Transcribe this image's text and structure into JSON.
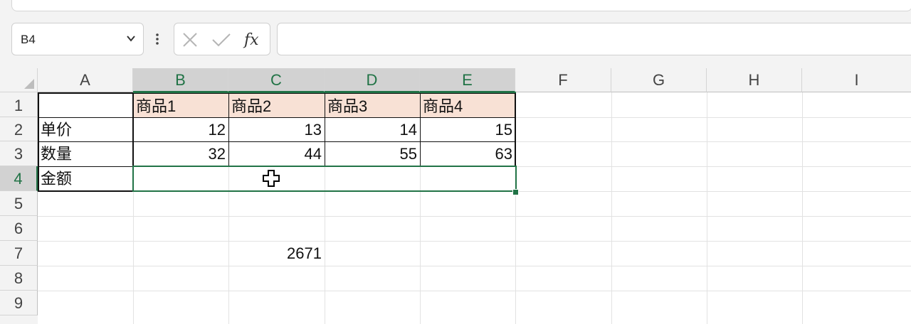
{
  "formula_bar": {
    "name_box": "B4",
    "cancel_icon": "cancel-icon",
    "enter_icon": "check-icon",
    "fx_icon": "fx-icon",
    "formula": ""
  },
  "columns": [
    "A",
    "B",
    "C",
    "D",
    "E",
    "F",
    "G",
    "H",
    "I"
  ],
  "rows": [
    "1",
    "2",
    "3",
    "4",
    "5",
    "6",
    "7",
    "8",
    "9"
  ],
  "selected_cell": "B4",
  "selection_range": "B4:E4",
  "cells": {
    "B1": "商品1",
    "C1": "商品2",
    "D1": "商品3",
    "E1": "商品4",
    "A2": "单价",
    "B2": "12",
    "C2": "13",
    "D2": "14",
    "E2": "15",
    "A3": "数量",
    "B3": "32",
    "C3": "44",
    "D3": "55",
    "E3": "63",
    "A4": "金额",
    "C6": "2671"
  },
  "colors": {
    "accent": "#217346",
    "header_fill": "#f8e1d5",
    "selected_header_bg": "#d2d2d2"
  },
  "cursor_icon": "cell-select-cursor-icon"
}
